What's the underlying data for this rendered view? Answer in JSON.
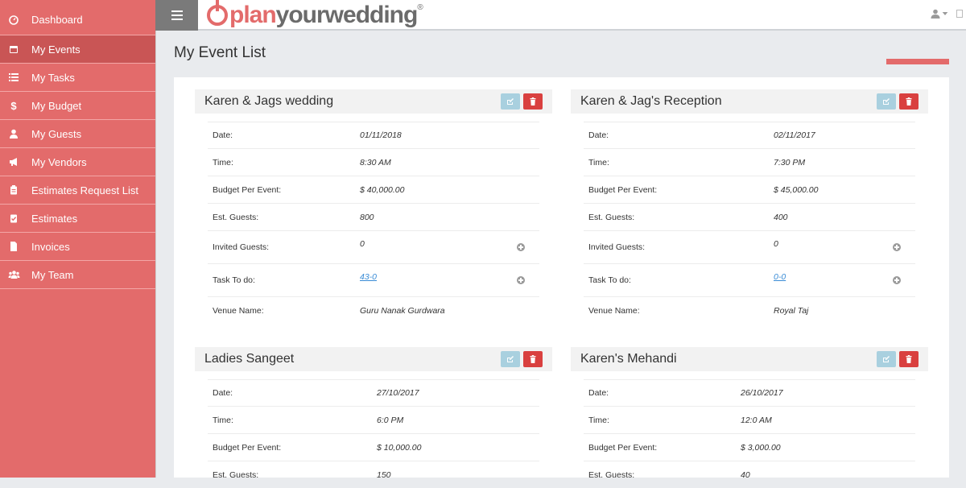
{
  "sidebar": {
    "items": [
      {
        "label": "Dashboard",
        "icon": "dashboard-icon"
      },
      {
        "label": "My Events",
        "icon": "calendar-icon"
      },
      {
        "label": "My Tasks",
        "icon": "list-icon"
      },
      {
        "label": "My Budget",
        "icon": "dollar-icon"
      },
      {
        "label": "My Guests",
        "icon": "user-icon"
      },
      {
        "label": "My Vendors",
        "icon": "megaphone-icon"
      },
      {
        "label": "Estimates Request List",
        "icon": "clipboard-icon"
      },
      {
        "label": "Estimates",
        "icon": "clipboard-check-icon"
      },
      {
        "label": "Invoices",
        "icon": "file-icon"
      },
      {
        "label": "My Team",
        "icon": "users-icon"
      }
    ]
  },
  "header": {
    "logo_part1": "plan",
    "logo_part2": "yourwedding",
    "logo_reg": "®"
  },
  "page": {
    "title": "My Event List"
  },
  "events": [
    {
      "title": "Karen & Jags wedding",
      "labels": {
        "date": "Date:",
        "time": "Time:",
        "budget": "Budget Per Event:",
        "guests": "Est. Guests:",
        "invited": "Invited Guests:",
        "tasks": "Task To do:",
        "venue": "Venue Name:"
      },
      "date": "01/11/2018",
      "time": "8:30 AM",
      "budget": "$ 40,000.00",
      "guests": "800",
      "invited": "0",
      "tasks": "43-0",
      "venue": "Guru Nanak Gurdwara"
    },
    {
      "title": "Karen & Jag's Reception",
      "labels": {
        "date": "Date:",
        "time": "Time:",
        "budget": "Budget Per Event:",
        "guests": "Est. Guests:",
        "invited": "Invited Guests:",
        "tasks": "Task To do:",
        "venue": "Venue Name:"
      },
      "date": "02/11/2017",
      "time": "7:30 PM",
      "budget": "$ 45,000.00",
      "guests": "400",
      "invited": "0",
      "tasks": "0-0",
      "venue": "Royal Taj"
    },
    {
      "title": "Ladies Sangeet",
      "labels": {
        "date": "Date:",
        "time": "Time:",
        "budget": "Budget Per Event:",
        "guests": "Est. Guests:"
      },
      "date": "27/10/2017",
      "time": "6:0 PM",
      "budget": "$ 10,000.00",
      "guests": "150"
    },
    {
      "title": "Karen's Mehandi",
      "labels": {
        "date": "Date:",
        "time": "Time:",
        "budget": "Budget Per Event:",
        "guests": "Est. Guests:"
      },
      "date": "26/10/2017",
      "time": "12:0 AM",
      "budget": "$ 3,000.00",
      "guests": "40"
    }
  ],
  "colors": {
    "accent": "#e36b6b",
    "active": "#c95555",
    "edit": "#a9d0df",
    "delete": "#d9403f"
  }
}
